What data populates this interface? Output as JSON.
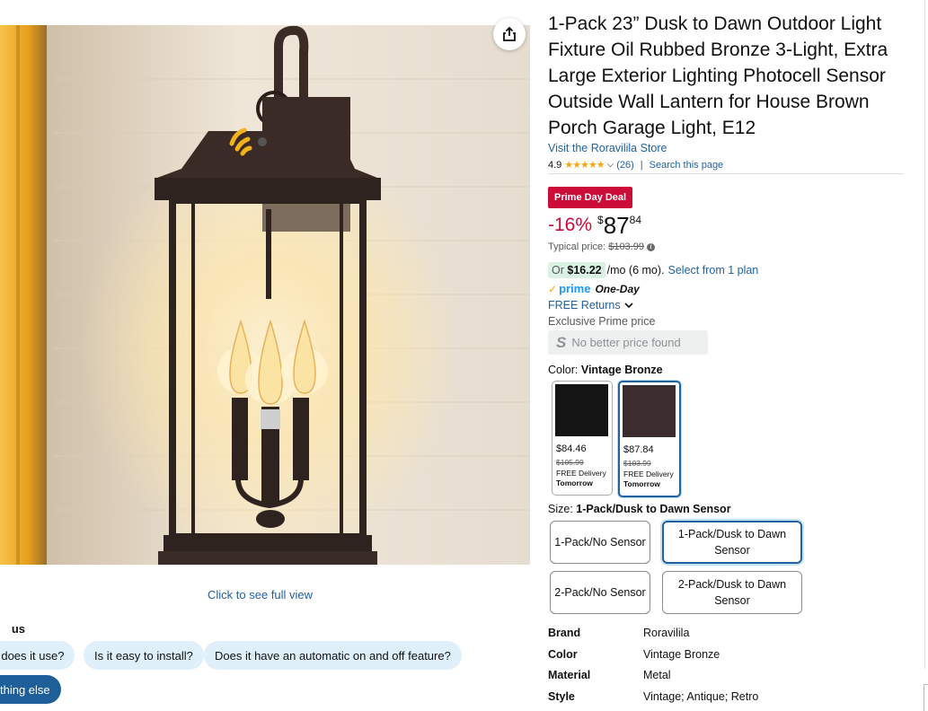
{
  "image": {
    "full_view_label": "Click to see full view"
  },
  "questions": {
    "heading": "us",
    "chips": [
      "os does it use?",
      "Is it easy to install?",
      "Does it have an automatic on and off feature?"
    ],
    "other": "thing else"
  },
  "product": {
    "title": "1-Pack 23” Dusk to Dawn Outdoor Light Fixture Oil Rubbed Bronze 3-Light, Extra Large Exterior Lighting Photocell Sensor Outside Wall Lantern for House Brown Porch Garage Light, E12",
    "store_link": "Visit the Roravilila Store",
    "rating": "4.9",
    "stars": "★★★★★",
    "review_count": "(26)",
    "search_page": "Search this page"
  },
  "pricing": {
    "deal_badge": "Prime Day Deal",
    "discount": "-16%",
    "currency": "$",
    "whole": "87",
    "fraction": "84",
    "typical_label": "Typical price:",
    "typical_price": "$103.99",
    "monthly_or": "Or",
    "monthly_amount": "$16.22",
    "monthly_term": "/mo (6 mo).",
    "monthly_plan_link": "Select from 1 plan",
    "prime_logo": "prime",
    "prime_speed": "One-Day",
    "free_returns": "FREE Returns",
    "exclusive": "Exclusive Prime price",
    "no_better": "No better price found",
    "no_better_icon": "S"
  },
  "color": {
    "label": "Color:",
    "selected": "Vintage Bronze",
    "options": [
      {
        "price": "$84.46",
        "was": "$105.99",
        "delivery": "FREE Delivery",
        "day": "Tomorrow",
        "swatch": "#141414"
      },
      {
        "price": "$87.84",
        "was": "$103.99",
        "delivery": "FREE Delivery",
        "day": "Tomorrow",
        "swatch": "#3b2d2e"
      }
    ]
  },
  "size": {
    "label": "Size:",
    "selected": "1-Pack/Dusk to Dawn Sensor",
    "options": [
      "1-Pack/No Sensor",
      "1-Pack/Dusk to Dawn Sensor",
      "2-Pack/No Sensor",
      "2-Pack/Dusk to Dawn Sensor"
    ]
  },
  "specs": [
    {
      "key": "Brand",
      "value": "Roravilila"
    },
    {
      "key": "Color",
      "value": "Vintage Bronze"
    },
    {
      "key": "Material",
      "value": "Metal"
    },
    {
      "key": "Style",
      "value": "Vintage; Antique; Retro"
    }
  ],
  "colors": {
    "link": "#2162a1",
    "deal": "#cc0c39",
    "prime": "#1a98ff",
    "lamp_bronze": "#3a2b26"
  }
}
